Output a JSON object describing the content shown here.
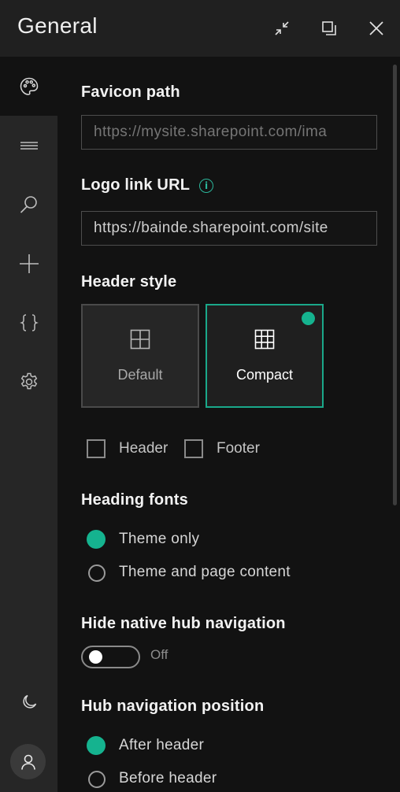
{
  "window": {
    "title": "General",
    "minimize_icon": "collapse-arrows-icon",
    "maximize_icon": "restore-window-icon",
    "close_icon": "close-icon"
  },
  "sidebar": {
    "items": [
      {
        "icon": "palette-icon",
        "active": true
      },
      {
        "icon": "menu-lines-icon",
        "active": false
      },
      {
        "icon": "search-icon",
        "active": false
      },
      {
        "icon": "plus-icon",
        "active": false
      },
      {
        "icon": "braces-icon",
        "active": false
      },
      {
        "icon": "gear-icon",
        "active": false
      }
    ],
    "bottom": [
      {
        "icon": "moon-icon"
      },
      {
        "icon": "person-icon"
      }
    ]
  },
  "form": {
    "favicon": {
      "label": "Favicon path",
      "placeholder": "https://mysite.sharepoint.com/ima"
    },
    "logo": {
      "label": "Logo link URL",
      "info_glyph": "i",
      "value": "https://bainde.sharepoint.com/site"
    },
    "header_style": {
      "label": "Header style",
      "options": [
        {
          "label": "Default",
          "icon": "grid-2x2-icon",
          "selected": false
        },
        {
          "label": "Compact",
          "icon": "grid-3x3-icon",
          "selected": true
        }
      ]
    },
    "checkboxes": [
      {
        "label": "Header",
        "checked": false
      },
      {
        "label": "Footer",
        "checked": false
      }
    ],
    "heading_fonts": {
      "label": "Heading fonts",
      "options": [
        {
          "label": "Theme only",
          "selected": true
        },
        {
          "label": "Theme and page content",
          "selected": false
        }
      ]
    },
    "hide_hub": {
      "label": "Hide native hub navigation",
      "state": "Off"
    },
    "hub_position": {
      "label": "Hub navigation position",
      "options": [
        {
          "label": "After header",
          "selected": true
        },
        {
          "label": "Before header",
          "selected": false
        }
      ]
    }
  },
  "colors": {
    "accent": "#15b38f",
    "background": "#121212",
    "sidebar": "#262626",
    "titlebar": "#202020"
  }
}
